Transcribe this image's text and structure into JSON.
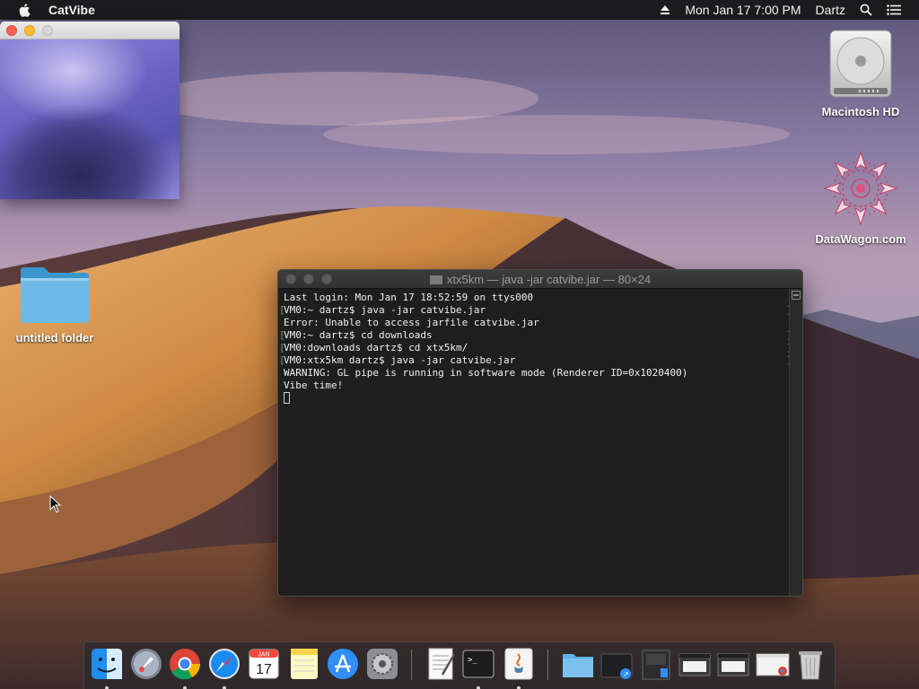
{
  "menubar": {
    "app_name": "CatVibe",
    "clock": "Mon Jan 17  7:00 PM",
    "user": "Dartz",
    "icons": [
      "apple-icon",
      "eject-icon",
      "spotlight-search-icon",
      "notification-center-icon"
    ]
  },
  "catvibe_window": {
    "traffic_lights": [
      "close",
      "minimize",
      "zoom"
    ]
  },
  "desktop": {
    "icons": [
      {
        "label": "Macintosh HD",
        "icon": "hard-drive-icon"
      },
      {
        "label": "DataWagon.com",
        "icon": "mandala-icon"
      },
      {
        "label": "untitled folder",
        "icon": "folder-icon"
      }
    ]
  },
  "terminal": {
    "title": "xtx5km — java -jar catvibe.jar — 80×24",
    "lines": [
      {
        "text": "Last login: Mon Jan 17 18:52:59 on ttys000",
        "marked": false
      },
      {
        "text": "VM0:~ dartz$ java -jar catvibe.jar",
        "marked": true
      },
      {
        "text": "Error: Unable to access jarfile catvibe.jar",
        "marked": false
      },
      {
        "text": "VM0:~ dartz$ cd downloads",
        "marked": true
      },
      {
        "text": "VM0:downloads dartz$ cd xtx5km/",
        "marked": true
      },
      {
        "text": "VM0:xtx5km dartz$ java -jar catvibe.jar",
        "marked": true
      },
      {
        "text": "WARNING: GL pipe is running in software mode (Renderer ID=0x1020400)",
        "marked": false
      },
      {
        "text": "Vibe time!",
        "marked": false
      }
    ]
  },
  "dock": {
    "items": [
      {
        "name": "finder",
        "icon": "finder-icon",
        "running": true
      },
      {
        "name": "launchpad",
        "icon": "launchpad-icon",
        "running": false
      },
      {
        "name": "chrome",
        "icon": "chrome-icon",
        "running": true
      },
      {
        "name": "safari",
        "icon": "safari-icon",
        "running": true
      },
      {
        "name": "calendar",
        "icon": "calendar-icon",
        "running": false,
        "month": "JAN",
        "day": "17"
      },
      {
        "name": "notes",
        "icon": "notes-icon",
        "running": false
      },
      {
        "name": "app-store",
        "icon": "app-store-icon",
        "running": false
      },
      {
        "name": "system-preferences",
        "icon": "system-preferences-icon",
        "running": false
      },
      {
        "name": "textedit",
        "icon": "textedit-icon",
        "running": false
      },
      {
        "name": "terminal",
        "icon": "terminal-icon",
        "running": true
      },
      {
        "name": "java",
        "icon": "java-icon",
        "running": true
      },
      {
        "name": "applications",
        "icon": "applications-folder-icon",
        "running": false
      },
      {
        "name": "documents",
        "icon": "documents-folder-icon",
        "running": false
      },
      {
        "name": "downloads-stack",
        "icon": "downloads-stack-icon",
        "running": false
      },
      {
        "name": "window-thumbnail-1",
        "icon": "window-thumbnail-icon",
        "running": false
      },
      {
        "name": "window-thumbnail-2",
        "icon": "window-thumbnail-icon",
        "running": false
      },
      {
        "name": "window-thumbnail-3",
        "icon": "window-thumbnail-icon",
        "running": false
      },
      {
        "name": "trash",
        "icon": "trash-icon",
        "running": false
      }
    ]
  },
  "colors": {
    "menubar_bg": "#1b1b1d",
    "terminal_bg": "#1e1e1e",
    "close_red": "#fc5f57",
    "minimize_yellow": "#fdbc2e"
  }
}
